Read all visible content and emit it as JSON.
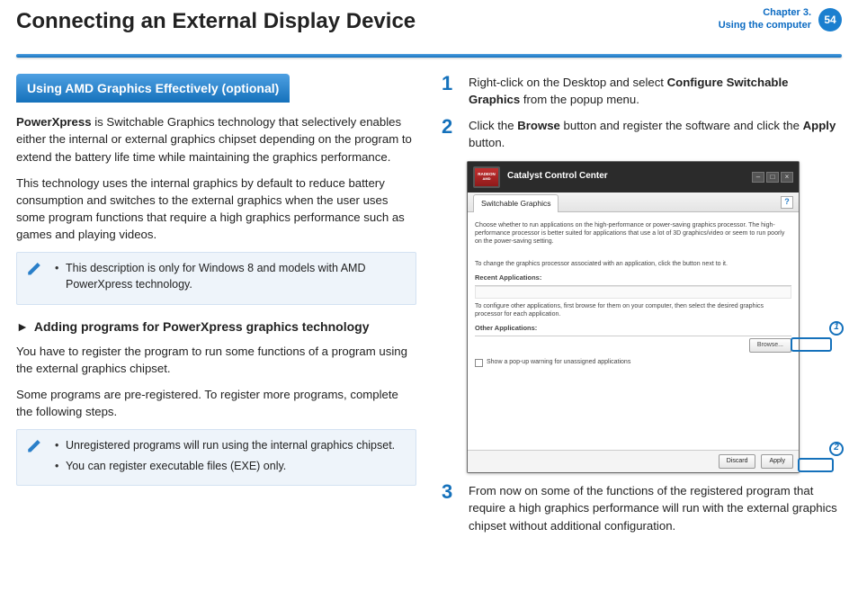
{
  "header": {
    "title": "Connecting an External Display Device",
    "chapter_line1": "Chapter 3.",
    "chapter_line2": "Using the computer",
    "page_number": "54"
  },
  "left": {
    "blue_heading": "Using AMD Graphics Effectively (optional)",
    "intro_strong": "PowerXpress",
    "intro_rest": " is Switchable Graphics technology that selectively enables either the internal or external graphics chipset depending on the program to extend the battery life time while maintaining the graphics performance.",
    "para2": "This technology uses the internal graphics by default to reduce battery consumption and switches to the external graphics when the user uses some program functions that require a high graphics performance such as games and playing videos.",
    "note1_item1": "This description is only for Windows 8 and models with AMD PowerXpress technology.",
    "sub_heading": "Adding programs for PowerXpress graphics technology",
    "para3": "You have to register the program to run some functions of a program using the external graphics chipset.",
    "para4": "Some programs are pre-registered. To register more programs, complete the following steps.",
    "note2_item1": "Unregistered programs will run using the internal graphics chipset.",
    "note2_item2": "You can register executable files (EXE) only."
  },
  "right": {
    "steps": {
      "s1_num": "1",
      "s1_a": "Right-click on the Desktop and select ",
      "s1_b": "Configure Switchable Graphics",
      "s1_c": " from the popup menu.",
      "s2_num": "2",
      "s2_a": "Click the ",
      "s2_b": "Browse",
      "s2_c": " button and register the software and click the ",
      "s2_d": "Apply",
      "s2_e": " button.",
      "s3_num": "3",
      "s3_text": "From now on some of the functions of the registered program that require a high graphics performance will run with the external graphics chipset without additional configuration."
    },
    "ccc": {
      "badge_top": "RADEON",
      "badge_bottom": "AMD",
      "title": "Catalyst Control Center",
      "tab": "Switchable Graphics",
      "help": "?",
      "desc1": "Choose whether to run applications on the high-performance or power-saving graphics processor. The high-performance processor is better suited for applications that use a lot of 3D graphics/video or seem to run poorly on the power-saving setting.",
      "desc2": "To change the graphics processor associated with an application, click the button next to it.",
      "sub_recent": "Recent Applications:",
      "desc3": "To configure other applications, first browse for them on your computer, then select the desired graphics processor for each application.",
      "sub_other": "Other Applications:",
      "browse": "Browse...",
      "check_label": "Show a pop-up warning for unassigned applications",
      "discard": "Discard",
      "apply": "Apply",
      "callout1": "1",
      "callout2": "2"
    }
  }
}
